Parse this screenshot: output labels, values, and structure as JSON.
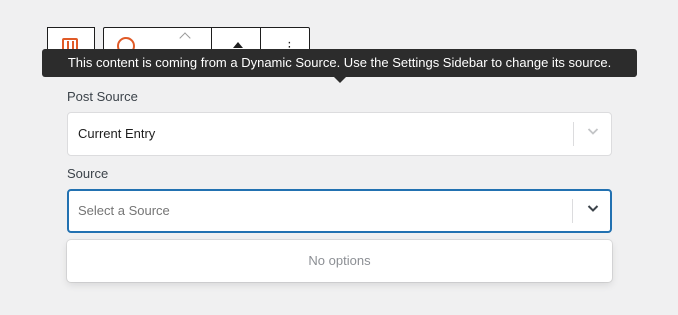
{
  "tooltip": {
    "text": "This content is coming from a Dynamic Source. Use the Settings Sidebar to change its source."
  },
  "form": {
    "post_source": {
      "label": "Post Source",
      "value": "Current Entry"
    },
    "source": {
      "label": "Source",
      "placeholder": "Select a Source"
    },
    "menu": {
      "empty_text": "No options"
    }
  },
  "colors": {
    "accent": "#2271b1",
    "brand": "#e05a27",
    "tooltip_bg": "#2c2c2c",
    "background": "#f0f0f1"
  },
  "icons": {
    "block": "block-icon",
    "dynamic": "dynamic-source-icon",
    "move_up": "arrow-up-icon",
    "more": "more-options-icon",
    "chevron": "chevron-down-icon"
  }
}
